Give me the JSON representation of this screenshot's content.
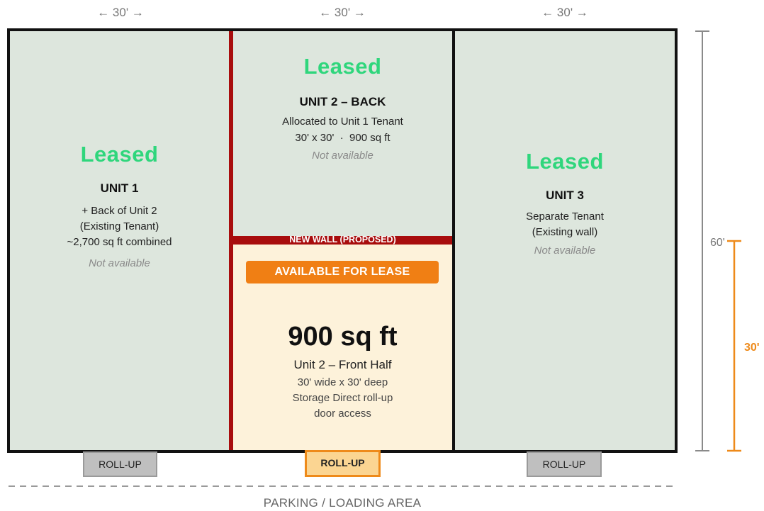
{
  "dimensions": {
    "top_left": "← 30' →",
    "top_mid": "← 30' →",
    "top_right": "← 30' →",
    "total_depth": "60'",
    "front_depth": "30'"
  },
  "unit1": {
    "status": "Leased",
    "title": "UNIT 1",
    "line1": "+ Back of Unit 2",
    "line2": "(Existing Tenant)",
    "line3": "~2,700 sq ft combined",
    "availability": "Not available"
  },
  "unit2_back": {
    "status": "Leased",
    "title": "UNIT 2 – BACK",
    "line1": "Allocated to Unit 1 Tenant",
    "line2": "30' x 30'  ·  900 sq ft",
    "availability": "Not available"
  },
  "unit3": {
    "status": "Leased",
    "title": "UNIT 3",
    "line1": "Separate Tenant",
    "line2": "(Existing wall)",
    "availability": "Not available"
  },
  "new_wall_label": "NEW WALL (PROPOSED)",
  "unit2_front": {
    "badge": "AVAILABLE FOR LEASE",
    "size": "900 sq ft",
    "name": "Unit 2 – Front Half",
    "line1": "30' wide x 30' deep",
    "line2": "Storage Direct roll-up",
    "line3": "door access"
  },
  "rollup_doors": {
    "left": "ROLL-UP",
    "middle": "ROLL-UP",
    "right": "ROLL-UP"
  },
  "parking_label": "PARKING / LOADING AREA",
  "colors": {
    "leased_green": "#2fd67c",
    "wall_red": "#a80d0d",
    "available_orange": "#f07f14",
    "floor_gray_green": "#dde6dd",
    "front_cream": "#fdf2da"
  }
}
